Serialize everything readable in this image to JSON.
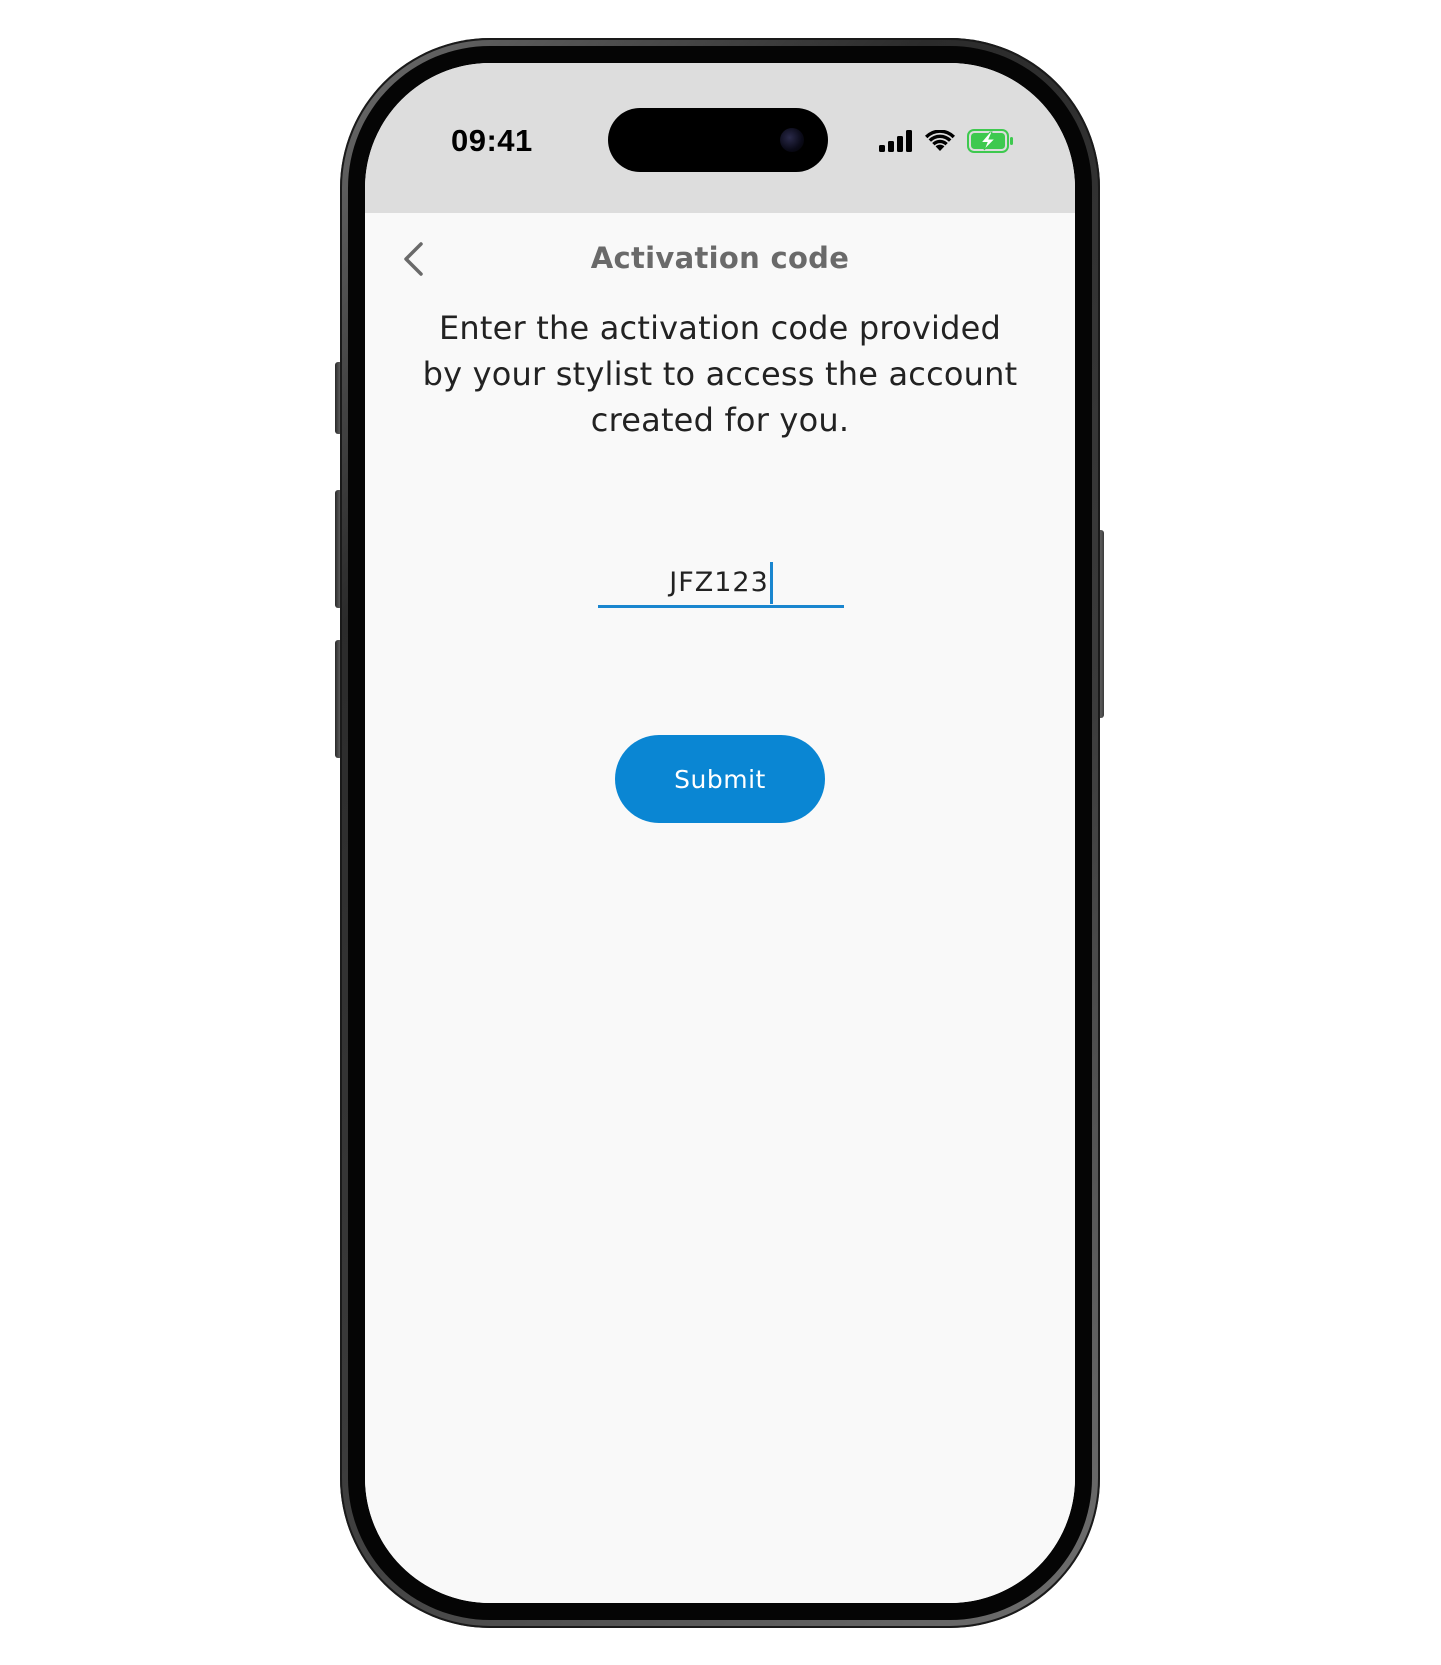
{
  "status_bar": {
    "time": "09:41",
    "icons": [
      "cellular-signal-icon",
      "wifi-icon",
      "battery-charging-icon"
    ],
    "battery_color": "#3ec94f"
  },
  "header": {
    "back_icon": "chevron-left-icon",
    "title": "Activation code"
  },
  "instructions": "Enter the activation code provided by your stylist to access the account created for you.",
  "code_input": {
    "value": "JFZ123"
  },
  "submit_button": {
    "label": "Submit"
  },
  "colors": {
    "accent": "#0a86d3",
    "status_bar_bg": "#dddddd",
    "screen_bg": "#f9f9f9",
    "title_text": "#6a6a6a"
  }
}
